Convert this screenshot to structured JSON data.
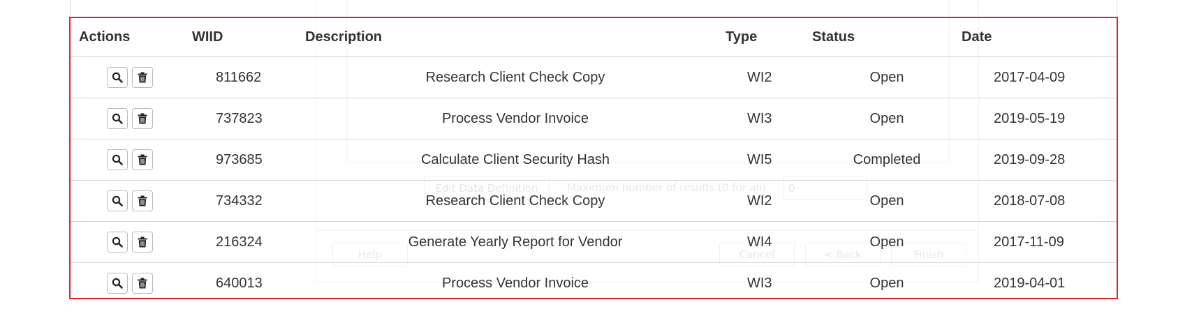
{
  "background_dialog": {
    "edit_button_label": "Edit Data Definition",
    "max_results_label": "Maximum number of results (0 for all)",
    "max_results_value": "0",
    "help_label": "Help",
    "cancel_label": "Cancel",
    "back_label": "< Back",
    "finish_label": "Finish"
  },
  "table": {
    "headers": {
      "actions": "Actions",
      "wiid": "WIID",
      "description": "Description",
      "type": "Type",
      "status": "Status",
      "date": "Date"
    },
    "rows": [
      {
        "wiid": "811662",
        "description": "Research Client Check Copy",
        "type": "WI2",
        "status": "Open",
        "date": "2017-04-09"
      },
      {
        "wiid": "737823",
        "description": "Process Vendor Invoice",
        "type": "WI3",
        "status": "Open",
        "date": "2019-05-19"
      },
      {
        "wiid": "973685",
        "description": "Calculate Client Security Hash",
        "type": "WI5",
        "status": "Completed",
        "date": "2019-09-28"
      },
      {
        "wiid": "734332",
        "description": "Research Client Check Copy",
        "type": "WI2",
        "status": "Open",
        "date": "2018-07-08"
      },
      {
        "wiid": "216324",
        "description": "Generate Yearly Report for Vendor",
        "type": "WI4",
        "status": "Open",
        "date": "2017-11-09"
      },
      {
        "wiid": "640013",
        "description": "Process Vendor Invoice",
        "type": "WI3",
        "status": "Open",
        "date": "2019-04-01"
      }
    ]
  },
  "icons": {
    "view": "search-icon",
    "delete": "trash-icon"
  },
  "colors": {
    "highlight_border": "#e02424",
    "row_divider": "#d6d6d6"
  }
}
